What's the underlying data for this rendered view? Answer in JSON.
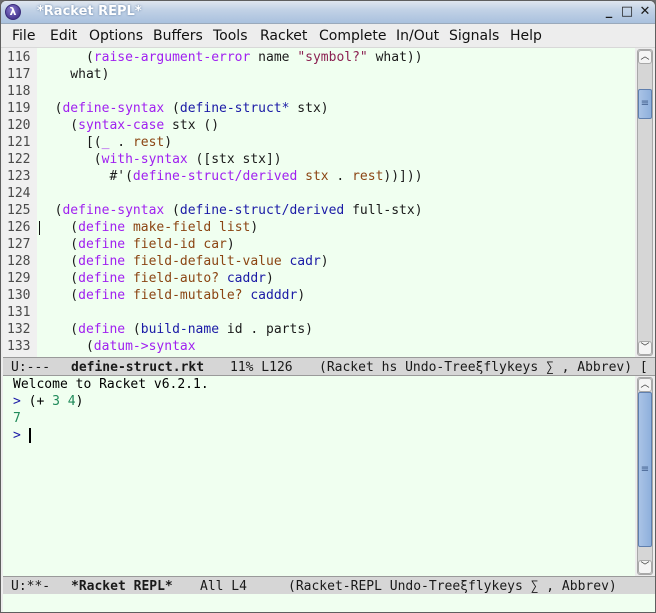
{
  "window": {
    "title": "*Racket REPL*",
    "app_icon": "racket-logo-icon",
    "controls": {
      "minimize": "_",
      "maximize": "□",
      "close": "✕"
    }
  },
  "menubar": {
    "items": [
      "File",
      "Edit",
      "Options",
      "Buffers",
      "Tools",
      "Racket",
      "Complete",
      "In/Out",
      "Signals",
      "Help"
    ]
  },
  "editor": {
    "cursor_line": "126",
    "lines": [
      {
        "n": "116",
        "tokens": [
          {
            "t": "      (",
            "c": "plain"
          },
          {
            "t": "raise-argument-error",
            "c": "kw"
          },
          {
            "t": " name ",
            "c": "plain"
          },
          {
            "t": "\"symbol?\"",
            "c": "str"
          },
          {
            "t": " what))",
            "c": "plain"
          }
        ]
      },
      {
        "n": "117",
        "tokens": [
          {
            "t": "    what)",
            "c": "plain"
          }
        ]
      },
      {
        "n": "118",
        "tokens": []
      },
      {
        "n": "119",
        "tokens": [
          {
            "t": "  (",
            "c": "plain"
          },
          {
            "t": "define-syntax",
            "c": "kw"
          },
          {
            "t": " (",
            "c": "plain"
          },
          {
            "t": "define-struct*",
            "c": "fn"
          },
          {
            "t": " stx)",
            "c": "plain"
          }
        ]
      },
      {
        "n": "120",
        "tokens": [
          {
            "t": "    (",
            "c": "plain"
          },
          {
            "t": "syntax-case",
            "c": "kw"
          },
          {
            "t": " stx ()",
            "c": "plain"
          }
        ]
      },
      {
        "n": "121",
        "tokens": [
          {
            "t": "      [(",
            "c": "plain"
          },
          {
            "t": "_",
            "c": "kw"
          },
          {
            "t": " . ",
            "c": "plain"
          },
          {
            "t": "rest",
            "c": "var"
          },
          {
            "t": ")",
            "c": "plain"
          }
        ]
      },
      {
        "n": "122",
        "tokens": [
          {
            "t": "       (",
            "c": "plain"
          },
          {
            "t": "with-syntax",
            "c": "kw"
          },
          {
            "t": " ([stx stx])",
            "c": "plain"
          }
        ]
      },
      {
        "n": "123",
        "tokens": [
          {
            "t": "         #'(",
            "c": "plain"
          },
          {
            "t": "define-struct/derived",
            "c": "kw"
          },
          {
            "t": " ",
            "c": "plain"
          },
          {
            "t": "stx",
            "c": "var"
          },
          {
            "t": " . ",
            "c": "plain"
          },
          {
            "t": "rest",
            "c": "var"
          },
          {
            "t": "))]))",
            "c": "plain"
          }
        ]
      },
      {
        "n": "124",
        "tokens": []
      },
      {
        "n": "125",
        "tokens": [
          {
            "t": "  (",
            "c": "plain"
          },
          {
            "t": "define-syntax",
            "c": "kw"
          },
          {
            "t": " (",
            "c": "plain"
          },
          {
            "t": "define-struct/derived",
            "c": "fn"
          },
          {
            "t": " full-stx)",
            "c": "plain"
          }
        ]
      },
      {
        "n": "126",
        "tokens": [
          {
            "t": "    (",
            "c": "plain"
          },
          {
            "t": "define",
            "c": "kw"
          },
          {
            "t": " ",
            "c": "plain"
          },
          {
            "t": "make-field",
            "c": "var"
          },
          {
            "t": " ",
            "c": "plain"
          },
          {
            "t": "list",
            "c": "var"
          },
          {
            "t": ")",
            "c": "plain"
          }
        ]
      },
      {
        "n": "127",
        "tokens": [
          {
            "t": "    (",
            "c": "plain"
          },
          {
            "t": "define",
            "c": "kw"
          },
          {
            "t": " ",
            "c": "plain"
          },
          {
            "t": "field-id",
            "c": "var"
          },
          {
            "t": " ",
            "c": "plain"
          },
          {
            "t": "car",
            "c": "var"
          },
          {
            "t": ")",
            "c": "plain"
          }
        ]
      },
      {
        "n": "128",
        "tokens": [
          {
            "t": "    (",
            "c": "plain"
          },
          {
            "t": "define",
            "c": "kw"
          },
          {
            "t": " ",
            "c": "plain"
          },
          {
            "t": "field-default-value",
            "c": "var"
          },
          {
            "t": " ",
            "c": "plain"
          },
          {
            "t": "cadr",
            "c": "fn"
          },
          {
            "t": ")",
            "c": "plain"
          }
        ]
      },
      {
        "n": "129",
        "tokens": [
          {
            "t": "    (",
            "c": "plain"
          },
          {
            "t": "define",
            "c": "kw"
          },
          {
            "t": " ",
            "c": "plain"
          },
          {
            "t": "field-auto?",
            "c": "var"
          },
          {
            "t": " ",
            "c": "plain"
          },
          {
            "t": "caddr",
            "c": "fn"
          },
          {
            "t": ")",
            "c": "plain"
          }
        ]
      },
      {
        "n": "130",
        "tokens": [
          {
            "t": "    (",
            "c": "plain"
          },
          {
            "t": "define",
            "c": "kw"
          },
          {
            "t": " ",
            "c": "plain"
          },
          {
            "t": "field-mutable?",
            "c": "var"
          },
          {
            "t": " ",
            "c": "plain"
          },
          {
            "t": "cadddr",
            "c": "fn"
          },
          {
            "t": ")",
            "c": "plain"
          }
        ]
      },
      {
        "n": "131",
        "tokens": []
      },
      {
        "n": "132",
        "tokens": [
          {
            "t": "    (",
            "c": "plain"
          },
          {
            "t": "define",
            "c": "kw"
          },
          {
            "t": " (",
            "c": "plain"
          },
          {
            "t": "build-name",
            "c": "fn"
          },
          {
            "t": " id . parts)",
            "c": "plain"
          }
        ]
      },
      {
        "n": "133",
        "tokens": [
          {
            "t": "      (",
            "c": "plain"
          },
          {
            "t": "datum->syntax",
            "c": "kw"
          }
        ]
      }
    ]
  },
  "modeline_top": {
    "status": "U:---",
    "buffer": "define-struct.rkt",
    "position": "11% L126",
    "modes": "(Racket hs Undo-Treeξflykeys ∑ , Abbrev) ["
  },
  "repl": {
    "welcome": "Welcome to Racket v6.2.1.",
    "prompt": ">",
    "input_open": "(+ ",
    "input_num1": "3",
    "input_space": " ",
    "input_num2": "4",
    "input_close": ")",
    "output": "7"
  },
  "modeline_bottom": {
    "status": "U:**-",
    "buffer": "*Racket REPL*",
    "position": "All L4",
    "modes": "(Racket-REPL Undo-Treeξflykeys ∑ , Abbrev)"
  },
  "scrollbars": {
    "editor": {
      "position_fraction": 0.11
    },
    "repl": {
      "position_fraction": 0.0
    }
  }
}
